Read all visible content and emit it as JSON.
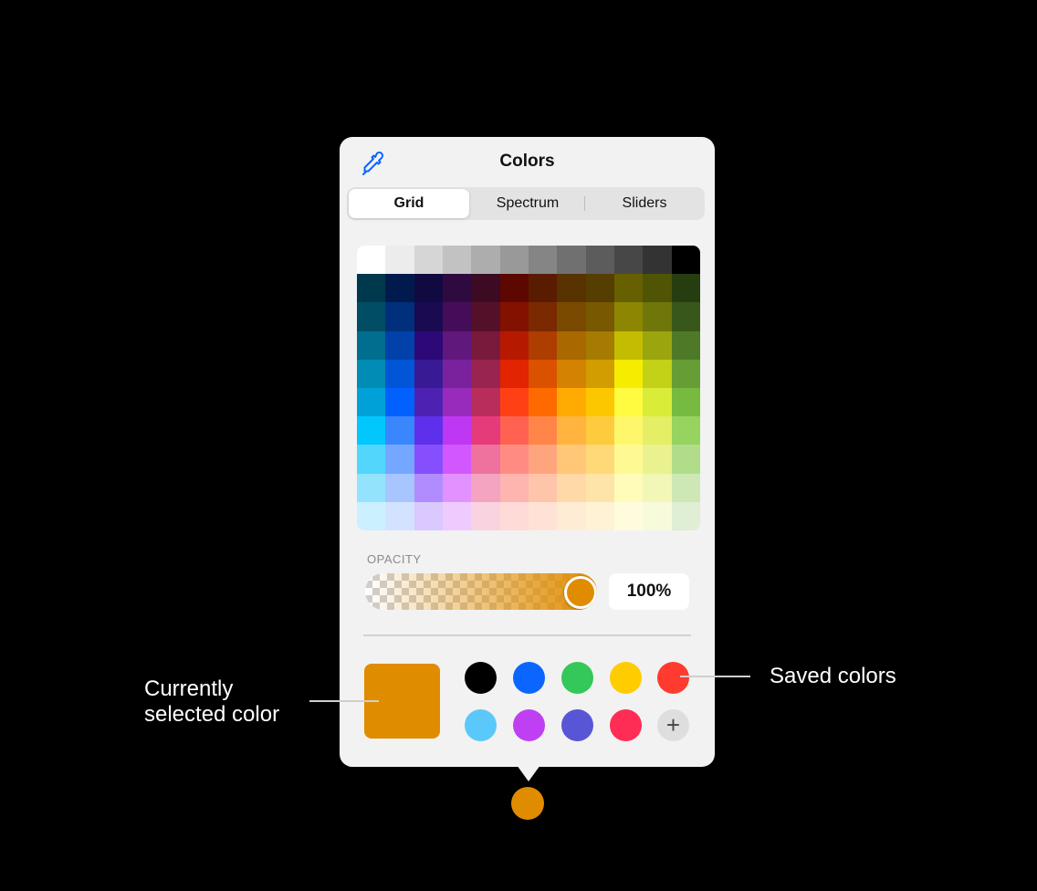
{
  "popover": {
    "title": "Colors",
    "tabs": [
      {
        "label": "Grid",
        "active": true
      },
      {
        "label": "Spectrum",
        "active": false
      },
      {
        "label": "Sliders",
        "active": false
      }
    ],
    "grid_colors": [
      [
        "#ffffff",
        "#ececec",
        "#d6d6d6",
        "#c2c2c2",
        "#adadad",
        "#999999",
        "#858585",
        "#707070",
        "#5c5c5c",
        "#474747",
        "#333333",
        "#000000"
      ],
      [
        "#00384d",
        "#001a4d",
        "#110a40",
        "#2e0a40",
        "#3c0a23",
        "#5c0700",
        "#5a1c00",
        "#583300",
        "#563d00",
        "#666000",
        "#4f5504",
        "#263e0f"
      ],
      [
        "#004d65",
        "#002f7b",
        "#1a0a52",
        "#450d59",
        "#551029",
        "#831100",
        "#7b2900",
        "#7a4a00",
        "#785800",
        "#8c8602",
        "#6f760a",
        "#38571a"
      ],
      [
        "#016e8f",
        "#0042a9",
        "#2c0977",
        "#61187c",
        "#791a3d",
        "#b51a00",
        "#ad3e00",
        "#a96800",
        "#a67b01",
        "#c4bc00",
        "#9ba50e",
        "#4e7a27"
      ],
      [
        "#008cb4",
        "#0056d6",
        "#371a94",
        "#7a219e",
        "#99244f",
        "#e22400",
        "#da5100",
        "#d38301",
        "#d19d01",
        "#f5ec00",
        "#c3d117",
        "#669d34"
      ],
      [
        "#00a1d8",
        "#0061fe",
        "#4d22b2",
        "#982abc",
        "#b92d5d",
        "#ff4015",
        "#ff6a00",
        "#ffab01",
        "#fdc700",
        "#fefb41",
        "#d9ec37",
        "#76bb40"
      ],
      [
        "#01c7fc",
        "#3a87fd",
        "#5e30eb",
        "#be38f3",
        "#e63b7a",
        "#ff6250",
        "#ff8648",
        "#feb43f",
        "#fecb3e",
        "#fff76b",
        "#e4ef65",
        "#96d35f"
      ],
      [
        "#52d6fc",
        "#74a7ff",
        "#864ffd",
        "#d357fe",
        "#ee719e",
        "#ff8c82",
        "#ffa57d",
        "#ffc777",
        "#ffd977",
        "#fff994",
        "#eaf28f",
        "#b1dd8b"
      ],
      [
        "#93e3fc",
        "#a7c6ff",
        "#b18cfe",
        "#e292fe",
        "#f4a4c0",
        "#ffb5af",
        "#ffc5ab",
        "#ffd9a8",
        "#fee4a8",
        "#fffbb9",
        "#f2f7b7",
        "#cde8b5"
      ],
      [
        "#cbf0ff",
        "#d3e2ff",
        "#d9c9fe",
        "#efcaff",
        "#f9d3e0",
        "#ffdbd8",
        "#ffe2d6",
        "#ffecd4",
        "#fff2d5",
        "#fefcdd",
        "#f7fadb",
        "#dfeed4"
      ]
    ],
    "opacity": {
      "label": "OPACITY",
      "value": 1.0,
      "display": "100%"
    },
    "current_color": "#e08c00",
    "saved_colors": [
      "#000000",
      "#0a66ff",
      "#34c759",
      "#ffcc00",
      "#ff3b30",
      "#5ac8fa",
      "#bf40f2",
      "#5856d6",
      "#ff2d55"
    ],
    "add_symbol": "+"
  },
  "callouts": {
    "current_line1": "Currently",
    "current_line2": "selected color",
    "saved": "Saved colors"
  },
  "icons": {
    "eyedropper": "eyedropper-icon",
    "add": "plus-icon"
  }
}
